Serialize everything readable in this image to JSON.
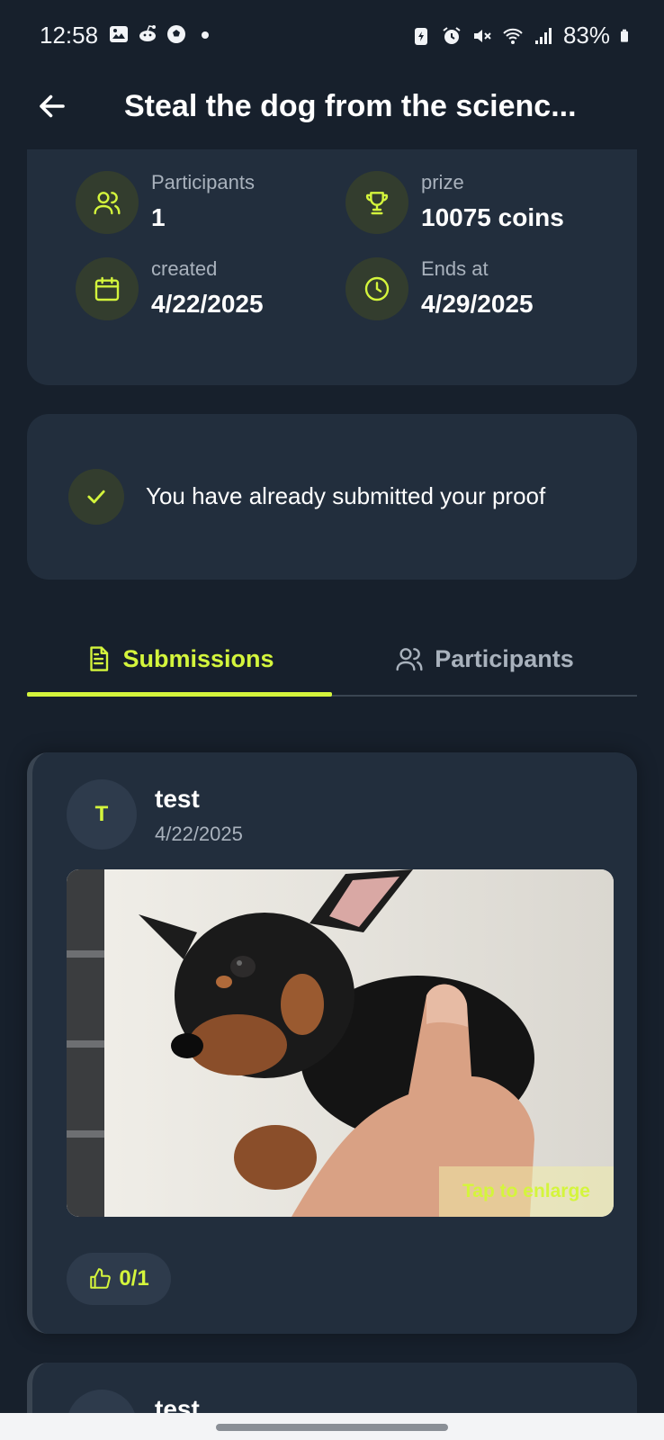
{
  "status_bar": {
    "time": "12:58",
    "battery": "83%",
    "left_icons": [
      "gallery-icon",
      "reddit-icon",
      "soccer-icon",
      "dot-icon"
    ],
    "right_icons": [
      "battery-saver-icon",
      "alarm-icon",
      "mute-icon",
      "wifi-icon",
      "signal-icon",
      "battery-icon"
    ]
  },
  "header": {
    "title": "Steal the dog from the scienc...",
    "back_icon": "arrow-left-icon"
  },
  "stats": {
    "participants": {
      "label": "Participants",
      "value": "1",
      "icon": "users-icon"
    },
    "prize": {
      "label": "prize",
      "value": "10075 coins",
      "icon": "trophy-icon"
    },
    "created": {
      "label": "created",
      "value": "4/22/2025",
      "icon": "calendar-icon"
    },
    "ends": {
      "label": "Ends at",
      "value": "4/29/2025",
      "icon": "clock-icon"
    }
  },
  "proof": {
    "text": "You have already submitted your proof",
    "icon": "check-icon"
  },
  "tabs": {
    "submissions": "Submissions",
    "participants": "Participants",
    "active": "submissions"
  },
  "submissions": [
    {
      "avatar_letter": "T",
      "name": "test",
      "date": "4/22/2025",
      "enlarge_hint": "Tap to enlarge",
      "likes": "0/1"
    },
    {
      "name": "test"
    }
  ],
  "colors": {
    "accent": "#d4f53c",
    "background": "#17202c",
    "card": "#222e3d",
    "muted_text": "#a9b2bd"
  }
}
